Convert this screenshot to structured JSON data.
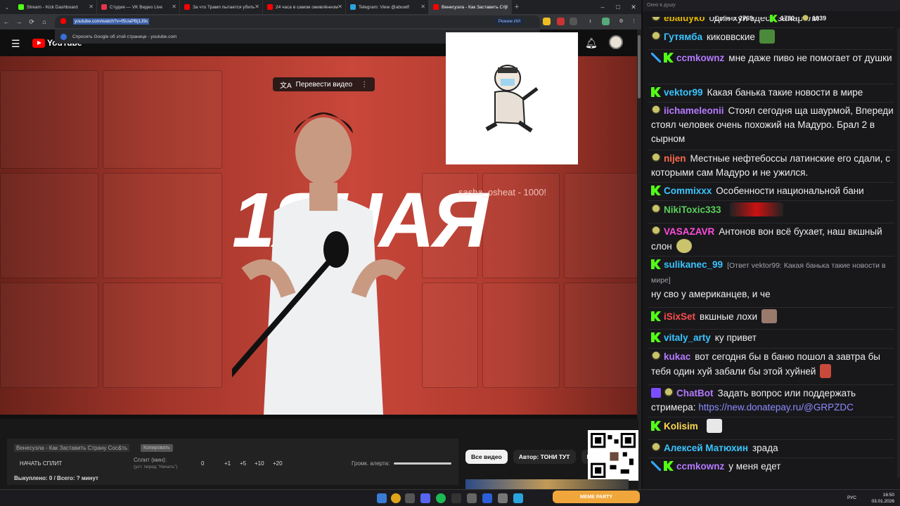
{
  "browser": {
    "tabs": [
      {
        "label": "Stream - Kick Dashboard",
        "color": "#53fc18",
        "active": false
      },
      {
        "label": "Студия — VK Видео Live",
        "color": "#e8344a",
        "active": false
      },
      {
        "label": "За что Трамп пытается убить",
        "color": "#ff0000",
        "active": false
      },
      {
        "label": "24 часа в самом оживлённом",
        "color": "#ff0000",
        "active": false
      },
      {
        "label": "Telegram: View @abuwtf",
        "color": "#2aa3df",
        "active": false
      },
      {
        "label": "Венесуэла - Как Заставить Стр",
        "color": "#ff0000",
        "active": true
      }
    ],
    "url": "youtube.com/watch?v=f5UaPBj1J9s",
    "suggestion": "Спросить Google об этой странице - youtube.com",
    "ai_mode_label": "Режим ИИ"
  },
  "youtube": {
    "logo": "YouTube"
  },
  "video": {
    "translate_label": "Перевести видео",
    "big_text": "1ЯНАЯ",
    "overlay_donation": "sasha_osheat - 1000!",
    "controls": [
      "⟲",
      "((·))",
      "▭",
      "▤",
      "▢",
      "▦",
      "◷",
      "⊞",
      "◉",
      "✻"
    ]
  },
  "split": {
    "stream_title": "Венесуэла - Как Заставить Страну Сос&ть",
    "copy_label": "Копировать",
    "start_split": "НАЧАТЬ СПЛИТ",
    "split_minutes_label": "Сплит (мин):",
    "split_hint": "(уст. перед \"Начать\")",
    "split_value": "0",
    "increments": [
      "+1",
      "+5",
      "+10",
      "+20"
    ],
    "alert_volume_label": "Громк. алерта:",
    "bought_label": "Выкуплено: 0 / Всего: ? минут"
  },
  "chips": [
    {
      "label": "Все видео",
      "selected": true
    },
    {
      "label": "Автор: ТОНИ ТУТ",
      "selected": false
    },
    {
      "label": "Нов",
      "selected": false
    }
  ],
  "chat": {
    "window_title": "Окно в душу",
    "online_label": "Online:",
    "online_count": "2769",
    "stat_kick": "1730",
    "stat_other": "1039",
    "messages": [
      {
        "user": "ebaiuyko",
        "color": "#e6b800",
        "badges": [
          "emo"
        ],
        "text": "один хуй здесь запарили"
      },
      {
        "user": "Гутямба",
        "color": "#39c5ff",
        "badges": [
          "emo"
        ],
        "text": "киковвские"
      },
      {
        "user": "ccmkownz",
        "color": "#b57aff",
        "badges": [
          "sword",
          "k"
        ],
        "text": "мне даже пиво не помогает от душки"
      },
      {
        "user": "vektor99",
        "color": "#39c5ff",
        "badges": [
          "k"
        ],
        "text": "Какая банька такие новости в мире"
      },
      {
        "user": "iichameleonii",
        "color": "#b57aff",
        "badges": [
          "emo"
        ],
        "text": "Стоял сегодня щa шаурмой, Впереди стоял человек очень похожий на Мадуро. Брал 2 в сырном"
      },
      {
        "user": "nijen",
        "color": "#ff6a4d",
        "badges": [
          "emo"
        ],
        "text": "Местные нефтебоссы латинские его сдали, с которыми сам Мадуро и не ужился."
      },
      {
        "user": "Commixxx",
        "color": "#39c5ff",
        "badges": [
          "k"
        ],
        "text": "Особенности национальной бани"
      },
      {
        "user": "NikiToxic333",
        "color": "#5ad05a",
        "badges": [
          "emo"
        ],
        "text": ""
      },
      {
        "user": "VASAZAVR",
        "color": "#ff4ddb",
        "badges": [
          "emo"
        ],
        "text": "Антонов вон всё бухает, наш вкшный слон"
      },
      {
        "user": "sulikanec_99",
        "color": "#39c5ff",
        "badges": [
          "k"
        ],
        "reply": "[Ответ vektor99: Какая банька такие новости в мире]",
        "text": "ну сво у американцев, и че"
      },
      {
        "user": "iSixSet",
        "color": "#ff4d4d",
        "badges": [
          "k"
        ],
        "text": "вкшные лохи"
      },
      {
        "user": "vitaly_arty",
        "color": "#39c5ff",
        "badges": [
          "k"
        ],
        "text": "ку привет"
      },
      {
        "user": "kukac",
        "color": "#b57aff",
        "badges": [
          "emo"
        ],
        "text": "вот сегодня бы в баню пошол  а завтра бы тебя один хуй забали бы этой хуйней"
      },
      {
        "user": "ChatBot",
        "color": "#b57aff",
        "badges": [
          "bot",
          "emo"
        ],
        "text": "Задать вопрос или поддержать стримера:",
        "link": "https://new.donatepay.ru/@GRPZDC"
      },
      {
        "user": "Kolisim",
        "color": "#ffd84d",
        "badges": [
          "k"
        ],
        "text": ""
      },
      {
        "user": "Алексей Матюхин",
        "color": "#39c5ff",
        "badges": [
          "emo"
        ],
        "text": "зрада"
      },
      {
        "user": "ccmkownz",
        "color": "#b57aff",
        "badges": [
          "sword",
          "k"
        ],
        "text": "у меня едет"
      }
    ]
  },
  "taskbar": {
    "meme_party": "MEME PARTY",
    "language": "РУС",
    "time": "16:50",
    "date": "03.01.2026"
  }
}
